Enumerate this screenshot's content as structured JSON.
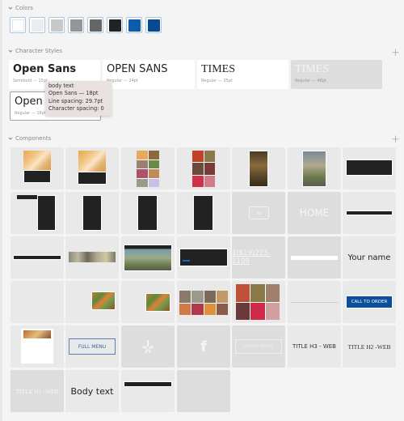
{
  "colors": {
    "title": "Colors",
    "swatches": [
      "#ffffff",
      "#ececec",
      "#c8c8c8",
      "#959595",
      "#666666",
      "#222222",
      "#0b5cad",
      "#084a8f"
    ]
  },
  "character_styles": {
    "title": "Character Styles",
    "items": [
      {
        "name": "Open Sans",
        "meta": "Semibold — 15pt"
      },
      {
        "name": "OPEN SANS",
        "meta": "Regular — 24pt"
      },
      {
        "name": "TIMES",
        "meta": "Regular — 35pt"
      },
      {
        "name": "TIMES",
        "meta": "Regular — 48pt"
      },
      {
        "name": "Open Sans",
        "meta": "Regular — 18pt"
      }
    ],
    "tooltip": {
      "line1": "body text",
      "line2": "Open Sans — 18pt",
      "line3": "Line spacing: 29.7pt",
      "line4": "Character spacing: 0"
    }
  },
  "components": {
    "title": "Components",
    "labels": {
      "home": "HOME",
      "phone": "1(619)223-1109",
      "your_name": "Your name",
      "call_to_order": "CALL TO ORDER",
      "full_menu": "FULL MENU",
      "learn_more": "LEARN MORE",
      "title_h3": "TITLE H3 - WEB",
      "title_h2": "TITLE H2 -WEB",
      "title_h1": "TITLE H1 -WEB",
      "body_text": "Body text",
      "yelp": "yelp-icon",
      "facebook": "f"
    },
    "accent_color": "#0b4f9c"
  }
}
